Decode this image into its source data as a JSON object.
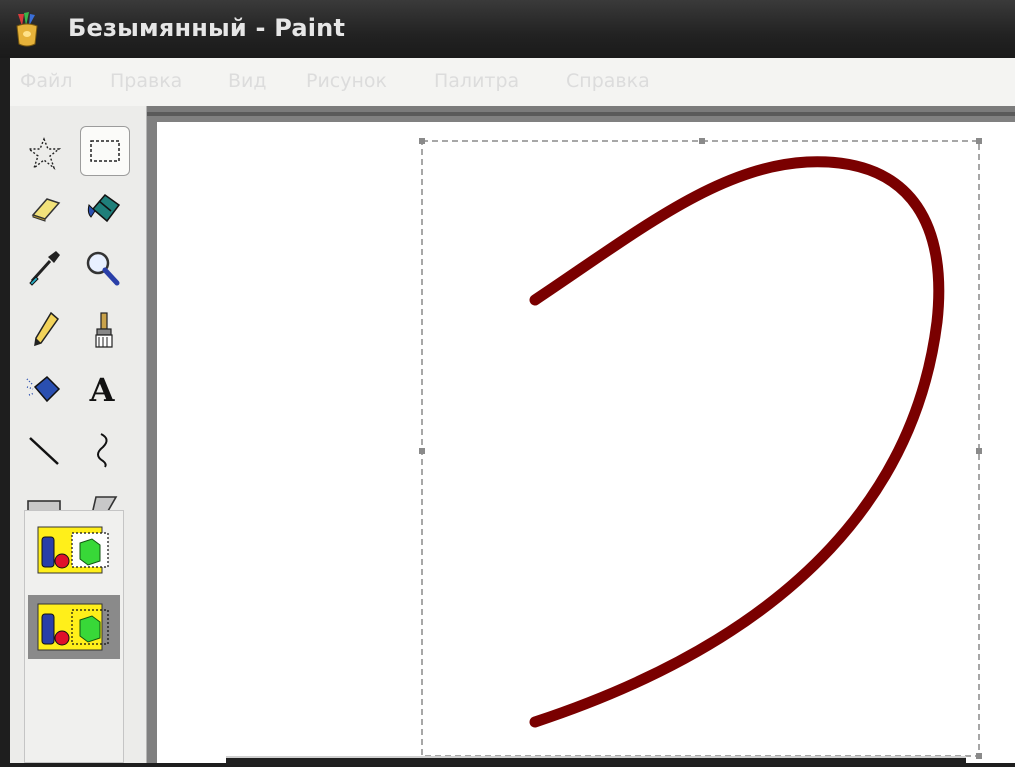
{
  "window": {
    "title": "Безымянный - Paint",
    "app_icon": "paint-palette-icon"
  },
  "menu": [
    {
      "label": "Файл"
    },
    {
      "label": "Правка"
    },
    {
      "label": "Вид"
    },
    {
      "label": "Рисунок"
    },
    {
      "label": "Палитра"
    },
    {
      "label": "Справка"
    }
  ],
  "tools": [
    {
      "name": "free-form-select",
      "icon": "free-form-select-icon",
      "selected": false
    },
    {
      "name": "rect-select",
      "icon": "rect-select-icon",
      "selected": true
    },
    {
      "name": "eraser",
      "icon": "eraser-icon",
      "selected": false
    },
    {
      "name": "fill",
      "icon": "fill-bucket-icon",
      "selected": false
    },
    {
      "name": "pick-color",
      "icon": "eyedropper-icon",
      "selected": false
    },
    {
      "name": "magnifier",
      "icon": "magnifier-icon",
      "selected": false
    },
    {
      "name": "pencil",
      "icon": "pencil-icon",
      "selected": false
    },
    {
      "name": "brush",
      "icon": "brush-icon",
      "selected": false
    },
    {
      "name": "airbrush",
      "icon": "airbrush-icon",
      "selected": false
    },
    {
      "name": "text",
      "icon": "text-tool-icon",
      "glyph": "A",
      "selected": false
    },
    {
      "name": "line",
      "icon": "line-icon",
      "selected": false
    },
    {
      "name": "curve",
      "icon": "curve-icon",
      "selected": false
    },
    {
      "name": "rectangle",
      "icon": "rectangle-icon",
      "selected": false
    },
    {
      "name": "polygon",
      "icon": "polygon-icon",
      "selected": false
    },
    {
      "name": "ellipse",
      "icon": "ellipse-icon",
      "selected": false
    },
    {
      "name": "rounded-rectangle",
      "icon": "rounded-rect-icon",
      "selected": false
    }
  ],
  "selection_options": [
    {
      "name": "opaque-selection",
      "icon": "opaque-selection-icon",
      "selected": false
    },
    {
      "name": "transparent-selection",
      "icon": "transparent-selection-icon",
      "selected": true
    }
  ],
  "drawing": {
    "stroke_color": "#7a0000",
    "shape": "curve-stroke"
  },
  "colors": {
    "titlebar": "#222222",
    "menubar": "#f4f4f2",
    "toolbox": "#ececea",
    "canvas": "#ffffff",
    "workspace": "#808080"
  }
}
